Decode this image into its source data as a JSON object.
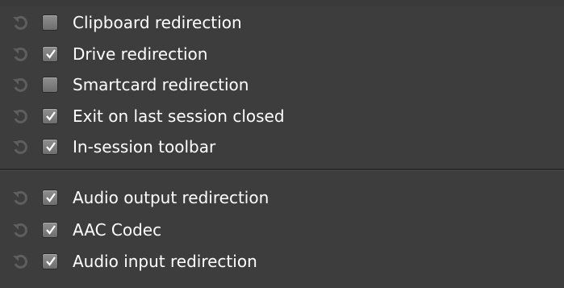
{
  "section1": {
    "items": [
      {
        "label": "Clipboard redirection",
        "checked": false
      },
      {
        "label": "Drive redirection",
        "checked": true
      },
      {
        "label": "Smartcard redirection",
        "checked": false
      },
      {
        "label": "Exit on last session closed",
        "checked": true
      },
      {
        "label": "In-session toolbar",
        "checked": true
      }
    ]
  },
  "section2": {
    "items": [
      {
        "label": "Audio output redirection",
        "checked": true
      },
      {
        "label": "AAC Codec",
        "checked": true
      },
      {
        "label": "Audio input redirection",
        "checked": true
      }
    ]
  },
  "icons": {
    "reset": "reset-icon",
    "check": "checkmark-icon"
  },
  "colors": {
    "background": "#3d3d3d",
    "text": "#ffffff",
    "separator": "#2b2b2b"
  }
}
